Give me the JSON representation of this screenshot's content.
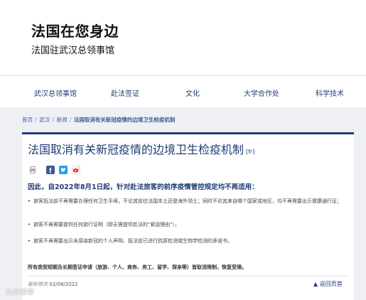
{
  "header": {
    "title": "法国在您身边",
    "subtitle": "法国驻武汉总领事馆"
  },
  "nav": {
    "items": [
      "武汉总领事馆",
      "赴法签证",
      "文化",
      "大学合作处",
      "科学技术"
    ]
  },
  "breadcrumb": {
    "items": [
      "首页",
      "武汉",
      "新闻"
    ],
    "current": "法国取消有关新冠疫情的边境卫生检疫机制"
  },
  "article": {
    "title": "法国取消有关新冠疫情的边境卫生检疫机制",
    "lang_link": "[fr]",
    "lead": "因此，自2022年8月1日起，针对赴法旅客的前序疫情管控规定均不再适用：",
    "bullets": [
      "旅客抵法前不再需要办理任何卫生手续，不论其前往法国本土还是海外领土；同时不论其来自哪个国家或地区，均不再需要出示健康通行证；",
      "旅客不再需要提供任何旅行证明（即无需提供赴法的\"紧迫理由\"）。",
      "旅客不再需要出示未感染新冠的个人声明、抵法前已进行抗原检测或生物学检测的承诺书。"
    ],
    "visa_note": "所有类型短期及长期签证申请（旅游、个人、商务、务工、留学、探亲等）皆取消限制，恢复受理。",
    "updated_label": "最新修改",
    "updated_date": "02/08/2022",
    "back_label": "返回页首"
  },
  "share": {
    "icons": [
      "print-icon",
      "facebook-icon",
      "twitter-icon",
      "weibo-icon"
    ],
    "colors": {
      "facebook": "#3b5998",
      "twitter": "#1da1f2",
      "weibo": "#e6162d"
    }
  },
  "watermark": "大众领事",
  "colors": {
    "brand_navy": "#1f3c74",
    "page_bg": "#eef0f4"
  }
}
